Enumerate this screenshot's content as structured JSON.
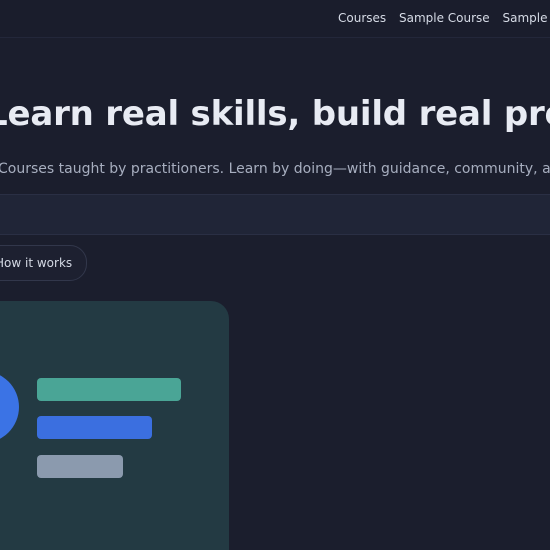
{
  "nav": {
    "items": [
      {
        "label": "Courses"
      },
      {
        "label": "Sample Course"
      },
      {
        "label": "Sample Lesson"
      }
    ]
  },
  "hero": {
    "title": "Learn real skills, build real projects",
    "subtitle": "Courses taught by practitioners. Learn by doing—with guidance, community, and feedback."
  },
  "cta": {
    "how_label": "How it works"
  },
  "illustration": {
    "colors": {
      "card": "#233a43",
      "circle": "#3b73e5",
      "bar_1": "#4aa596",
      "bar_2": "#3b6fe0",
      "bar_3": "#8b9aae"
    }
  }
}
